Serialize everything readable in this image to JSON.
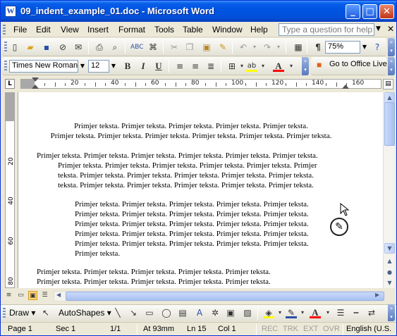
{
  "window": {
    "title": "09_indent_example_01.doc - Microsoft Word",
    "app_icon_letter": "W"
  },
  "menubar": {
    "items": [
      "File",
      "Edit",
      "View",
      "Insert",
      "Format",
      "Tools",
      "Table",
      "Window",
      "Help"
    ],
    "ask_placeholder": "Type a question for help"
  },
  "standard_toolbar": {
    "zoom": "75%"
  },
  "formatting_toolbar": {
    "font": "Times New Roman",
    "size": "12",
    "bold": "B",
    "italic": "I",
    "underline": "U",
    "office_live": "Go to Office Live"
  },
  "ruler": {
    "marks": [
      "20",
      "40",
      "60",
      "80",
      "100",
      "120",
      "140",
      "160"
    ]
  },
  "vertical_ruler": {
    "marks": [
      "20",
      "40",
      "60",
      "80"
    ]
  },
  "document": {
    "para1": [
      "Primjer teksta. Primjer teksta. Primjer teksta. Primjer teksta. Primjer teksta.",
      "Primjer teksta. Primjer teksta. Primjer teksta. Primjer teksta. Primjer teksta. Primjer teksta."
    ],
    "para2_first": "Primjer teksta. Primjer teksta. Primjer teksta. Primjer teksta. Primjer teksta. Primjer teksta.",
    "para2_rest": [
      "Primjer teksta. Primjer teksta. Primjer teksta. Primjer teksta. Primjer teksta. Primjer",
      "teksta. Primjer teksta. Primjer teksta. Primjer teksta. Primjer teksta. Primjer teksta.",
      "teksta. Primjer teksta. Primjer teksta. Primjer teksta. Primjer teksta. Primjer teksta."
    ],
    "para3": [
      "Primjer teksta. Primjer teksta. Primjer teksta. Primjer teksta. Primjer teksta.",
      "Primjer teksta. Primjer teksta. Primjer teksta. Primjer teksta. Primjer teksta.",
      "Primjer teksta. Primjer teksta. Primjer teksta. Primjer teksta. Primjer teksta.",
      "Primjer teksta. Primjer teksta. Primjer teksta. Primjer teksta. Primjer teksta.",
      "Primjer teksta. Primjer teksta. Primjer teksta. Primjer teksta. Primjer teksta.",
      "Primjer teksta."
    ],
    "para4": [
      "Primjer teksta. Primjer teksta. Primjer teksta. Primjer teksta. Primjer teksta.",
      "Primjer teksta. Primjer teksta. Primjer teksta. Primjer teksta. Primjer teksta."
    ]
  },
  "drawing_toolbar": {
    "draw": "Draw",
    "autoshapes": "AutoShapes"
  },
  "statusbar": {
    "page": "Page  1",
    "sec": "Sec  1",
    "pages": "1/1",
    "at": "At  93mm",
    "ln": "Ln  15",
    "col": "Col  1",
    "rec": "REC",
    "trk": "TRK",
    "ext": "EXT",
    "ovr": "OVR",
    "lang": "English (U.S."
  },
  "colors": {
    "title_bar": "#0054e3",
    "highlight": "#ffff00",
    "font_color": "#ff0000"
  }
}
